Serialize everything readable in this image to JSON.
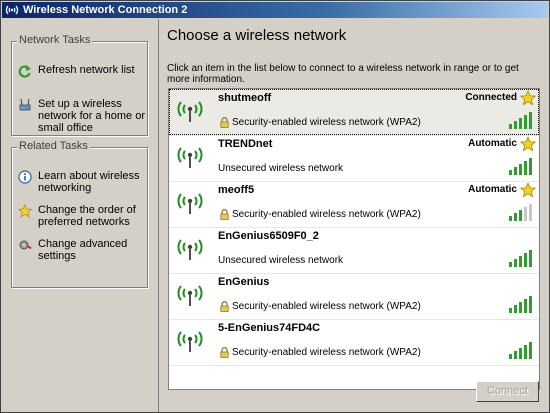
{
  "window": {
    "title": "Wireless Network Connection 2",
    "icon": "wireless-network-icon"
  },
  "network_tasks": {
    "title": "Network Tasks",
    "items": [
      {
        "label": "Refresh network list",
        "icon": "refresh-icon"
      },
      {
        "label": "Set up a wireless network for a home or small office",
        "icon": "setup-wireless-icon"
      }
    ]
  },
  "related_tasks": {
    "title": "Related Tasks",
    "items": [
      {
        "label": "Learn about wireless networking",
        "icon": "info-icon"
      },
      {
        "label": "Change the order of preferred networks",
        "icon": "star-icon"
      },
      {
        "label": "Change advanced settings",
        "icon": "settings-icon"
      }
    ]
  },
  "main": {
    "heading": "Choose a wireless network",
    "instructions": "Click an item in the list below to connect to a wireless network in range or to get more information.",
    "networks": [
      {
        "ssid": "shutmeoff",
        "status": "Connected",
        "preferred": true,
        "secured": true,
        "security": "Security-enabled wireless network (WPA2)",
        "signal_bars": 5,
        "selected": true
      },
      {
        "ssid": "TRENDnet",
        "status": "Automatic",
        "preferred": true,
        "secured": false,
        "security": "Unsecured wireless network",
        "signal_bars": 5,
        "selected": false
      },
      {
        "ssid": "meoff5",
        "status": "Automatic",
        "preferred": true,
        "secured": true,
        "security": "Security-enabled wireless network (WPA2)",
        "signal_bars": 3,
        "selected": false
      },
      {
        "ssid": "EnGenius6509F0_2",
        "status": "",
        "preferred": false,
        "secured": false,
        "security": "Unsecured wireless network",
        "signal_bars": 5,
        "selected": false
      },
      {
        "ssid": "EnGenius",
        "status": "",
        "preferred": false,
        "secured": true,
        "security": "Security-enabled wireless network (WPA2)",
        "signal_bars": 5,
        "selected": false
      },
      {
        "ssid": "5-EnGenius74FD4C",
        "status": "",
        "preferred": false,
        "secured": true,
        "security": "Security-enabled wireless network (WPA2)",
        "signal_bars": 5,
        "selected": false
      }
    ],
    "connect_label": "Connect"
  },
  "colors": {
    "titlebar_start": "#0a246a",
    "titlebar_end": "#a6caf0",
    "panel": "#d4d0c8",
    "signal_green": "#2e9e2e",
    "antenna_green": "#1f8f1f",
    "star_yellow": "#f6d21e"
  }
}
